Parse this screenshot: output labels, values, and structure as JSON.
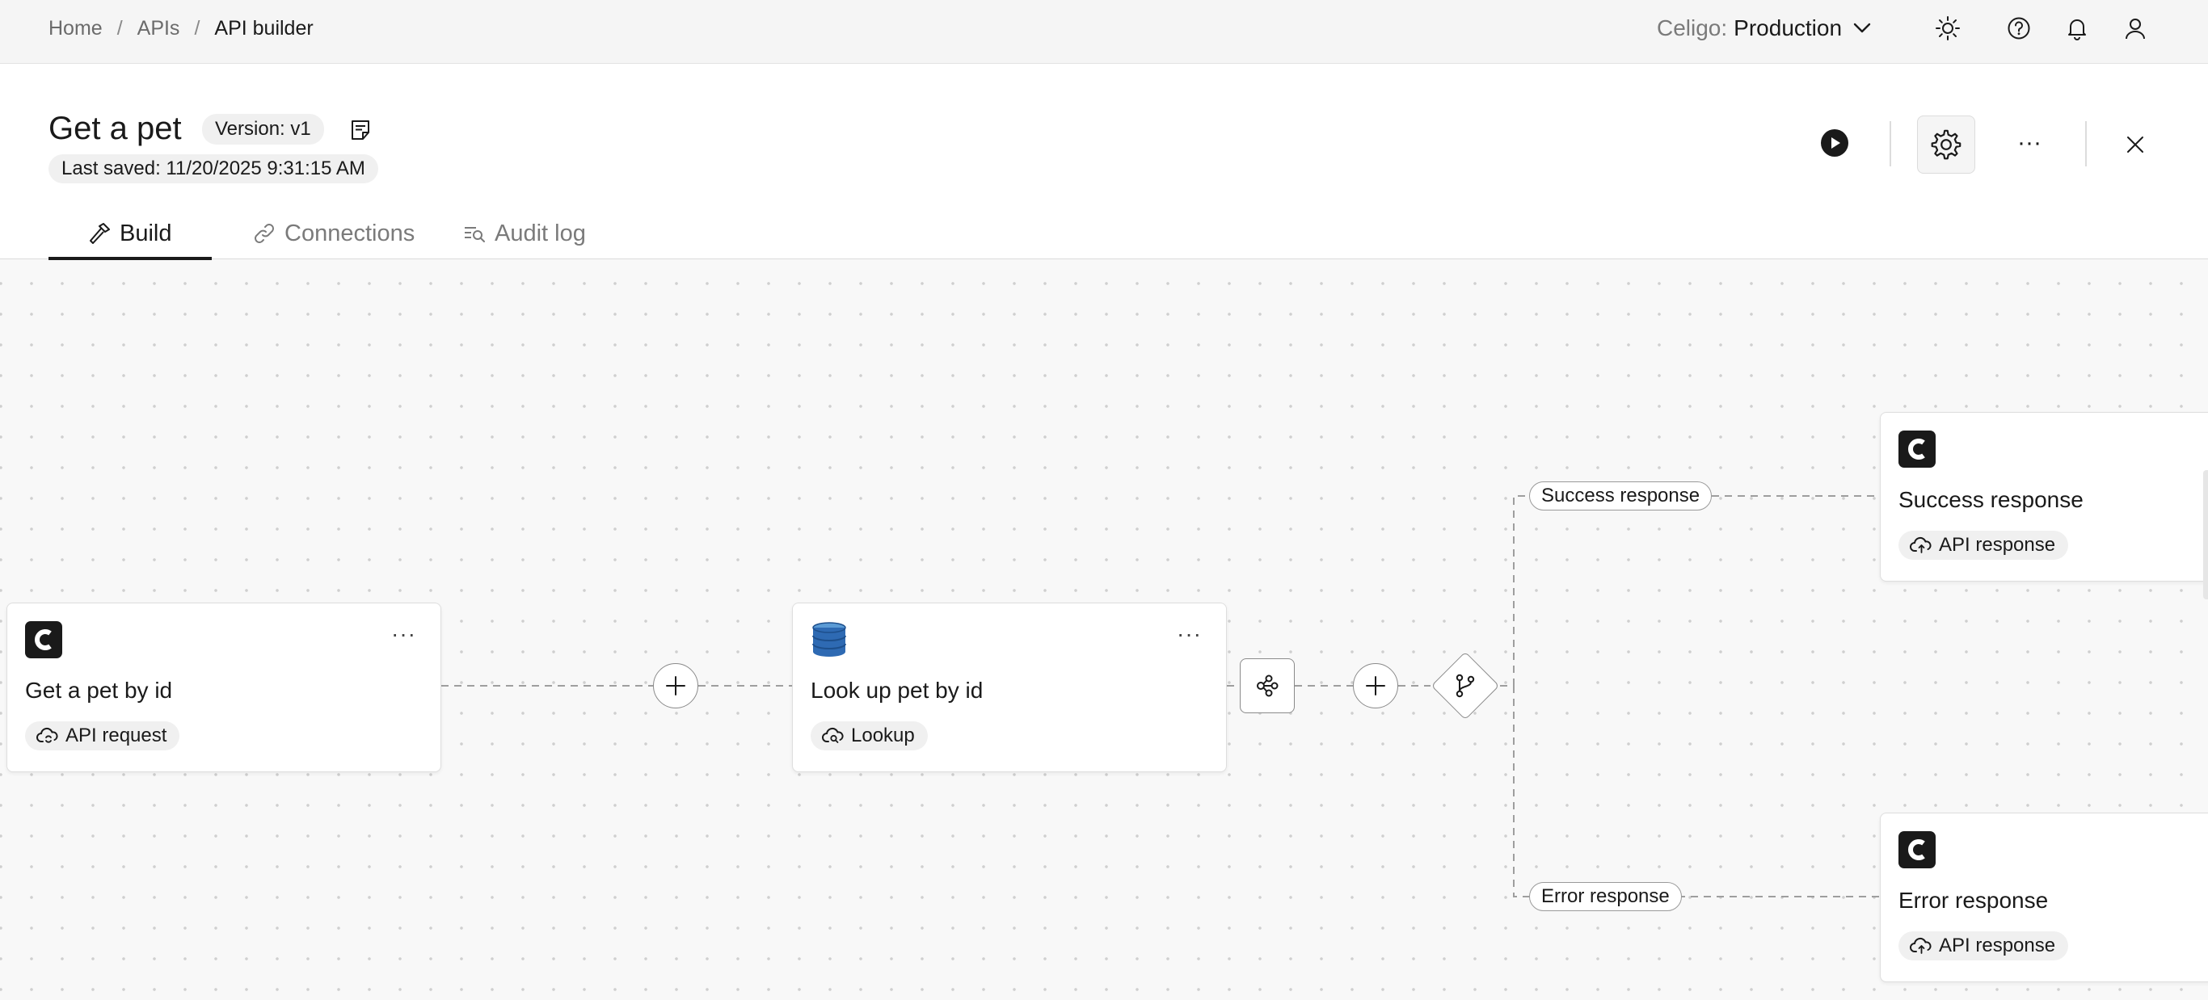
{
  "breadcrumb": {
    "home": "Home",
    "apis": "APIs",
    "current": "API builder",
    "sep": "/"
  },
  "environment": {
    "label": "Celigo:",
    "value": "Production"
  },
  "header": {
    "title": "Get a pet",
    "version": "Version: v1",
    "last_saved": "Last saved: 11/20/2025 9:31:15 AM",
    "more": "···"
  },
  "tabs": [
    {
      "label": "Build",
      "icon": "hammer-icon",
      "active": true
    },
    {
      "label": "Connections",
      "icon": "link-icon",
      "active": false
    },
    {
      "label": "Audit log",
      "icon": "audit-log-icon",
      "active": false
    }
  ],
  "nodes": {
    "request": {
      "name": "Get a pet by id",
      "badge": "API request",
      "more": "···"
    },
    "lookup": {
      "name": "Look up pet by id",
      "badge": "Lookup",
      "more": "···"
    },
    "success": {
      "name": "Success response",
      "badge": "API response"
    },
    "error": {
      "name": "Error response",
      "badge": "API response"
    }
  },
  "edges": {
    "success": "Success response",
    "error": "Error response"
  },
  "colors": {
    "accent": "#1a1a1a",
    "dynamo_blue": "#2e6ab3",
    "dashed_line": "#9e9e9e"
  }
}
